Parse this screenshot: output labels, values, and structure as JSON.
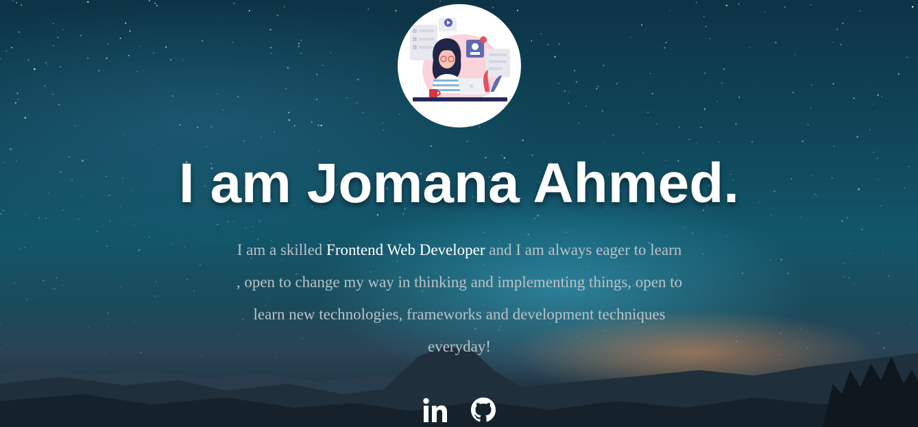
{
  "profile": {
    "heading": "I am Jomana Ahmed.",
    "intro_before": "I am a skilled ",
    "intro_highlight": "Frontend Web Developer",
    "intro_after": " and I am always eager to learn , open to change my way in thinking and implementing things, open to learn new technologies, frameworks and development techniques everyday!"
  },
  "avatar": {
    "icon": "developer-illustration-icon"
  },
  "socials": [
    {
      "icon": "linkedin-icon"
    },
    {
      "icon": "github-icon"
    }
  ],
  "colors": {
    "heading": "#ffffff",
    "body_text": "#b9c3c8",
    "highlight": "#ffffff",
    "sky_top": "#0d3345",
    "horizon_glow": "#e6965a"
  }
}
